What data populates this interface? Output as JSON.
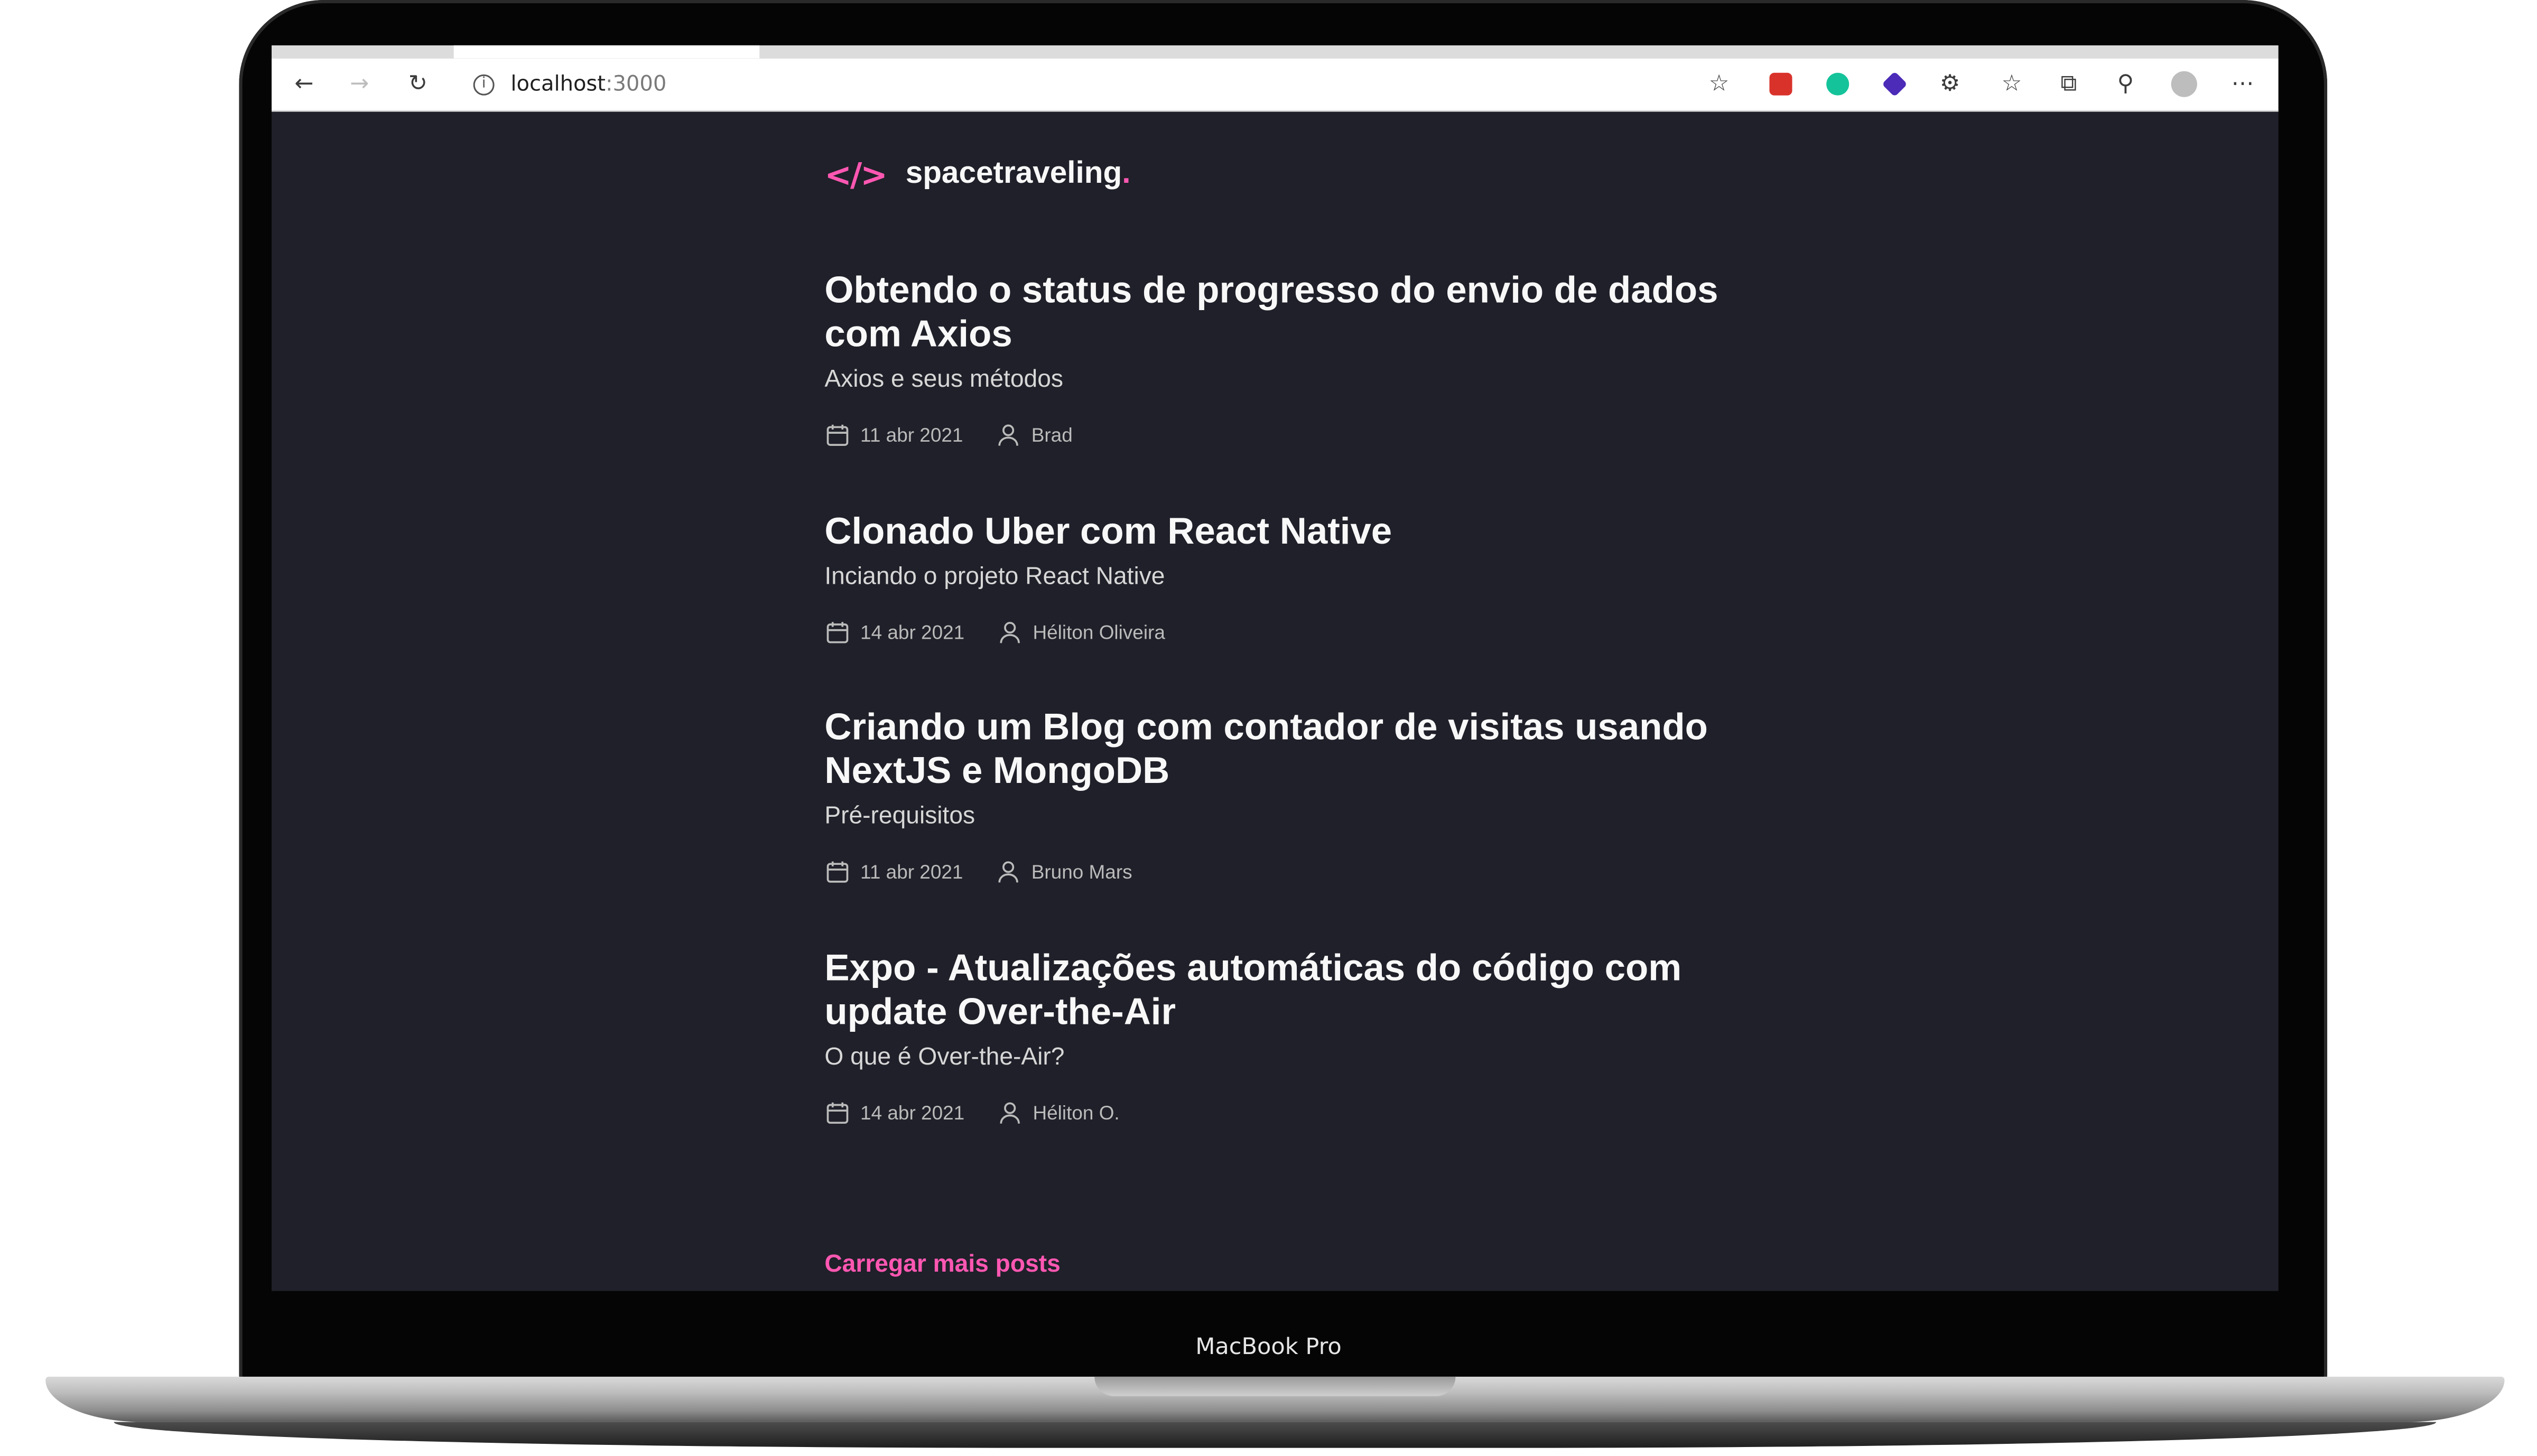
{
  "device": {
    "label": "MacBook Pro"
  },
  "browser": {
    "url_host": "localhost",
    "url_port": ":3000"
  },
  "site": {
    "logo_mark": "</>",
    "name": "spacetraveling",
    "name_dot": "."
  },
  "posts": [
    {
      "title": "Obtendo o status de progresso do envio de dados com Axios",
      "subtitle": "Axios e seus métodos",
      "date": "11 abr 2021",
      "author": "Brad"
    },
    {
      "title": "Clonado Uber com React Native",
      "subtitle": "Inciando o projeto React Native",
      "date": "14 abr 2021",
      "author": "Héliton Oliveira"
    },
    {
      "title": "Criando um Blog com contador de visitas usando NextJS e MongoDB",
      "subtitle": "Pré-requisitos",
      "date": "11 abr 2021",
      "author": "Bruno Mars"
    },
    {
      "title": "Expo - Atualizações automáticas do código com update Over-the-Air",
      "subtitle": "O que é Over-the-Air?",
      "date": "14 abr 2021",
      "author": "Héliton O."
    }
  ],
  "load_more_label": "Carregar mais posts",
  "colors": {
    "background": "#1f2029",
    "accent": "#ff57b2",
    "heading": "#f8f8f8",
    "muted": "#bbbbbb"
  },
  "icons": [
    "back-icon",
    "forward-icon",
    "reload-icon",
    "info-icon",
    "add-favorite-icon",
    "extension-icon",
    "puzzle-icon",
    "favorites-icon",
    "collections-icon",
    "share-icon",
    "profile-icon",
    "more-icon",
    "calendar-icon",
    "user-icon"
  ]
}
